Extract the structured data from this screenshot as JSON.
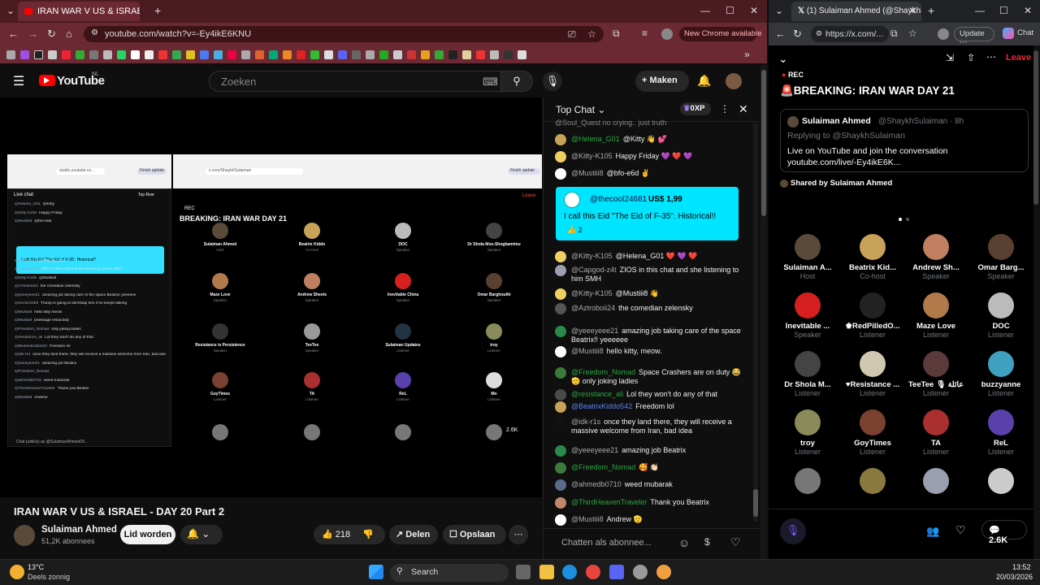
{
  "browser_left": {
    "tab_title": "IRAN WAR V US & ISRAEL",
    "url": "youtube.com/watch?v=-Ey4ikE6KNU",
    "new_chrome": "New Chrome available"
  },
  "youtube": {
    "brand": "YouTube",
    "region": "NL",
    "search_placeholder": "Zoeken",
    "create_label": "Maken",
    "video_title": "IRAN WAR V US & ISRAEL - DAY 20 Part 2",
    "channel_name": "Sulaiman Ahmed",
    "subscribers": "51,2K abonnees",
    "subscribe_label": "Lid worden",
    "likes": "218",
    "share_label": "Delen",
    "save_label": "Opslaan"
  },
  "embedded_capture": {
    "space_title": "BREAKING: IRAN WAR DAY 21",
    "rec": "REC",
    "live_chat": "Live chat",
    "top_row": "Top Row",
    "superchat_text": "I call this Eid 'The Eid of F-35'. Historical?",
    "count": "2.6K",
    "chat_publicly": "Chat publicly as @SulaimanAhmedOf...",
    "leave": "Leave",
    "left_url": "studio.youtube.co...",
    "right_url": "x.com/ShaykhSulaiman",
    "left_btn": "Finish update",
    "right_btn": "Finish update",
    "names": [
      {
        "n": "Sulaiman Ahmed",
        "r": "Host",
        "c": "#5a4a3a"
      },
      {
        "n": "Beatrix Kiddo",
        "r": "Co-host",
        "c": "#c9a25a"
      },
      {
        "n": "DOC",
        "r": "Speaker",
        "c": "#bbbbbb"
      },
      {
        "n": "Dr Shola Mos-Shogbamimu",
        "r": "Speaker",
        "c": "#444444"
      },
      {
        "n": "Maze Love",
        "r": "Speaker",
        "c": "#b07a4a"
      },
      {
        "n": "Andrew Sheets",
        "r": "Speaker",
        "c": "#c08060"
      },
      {
        "n": "Inevitable China",
        "r": "Speaker",
        "c": "#d62020"
      },
      {
        "n": "Omar Barghouthi",
        "r": "Speaker",
        "c": "#5a4030"
      },
      {
        "n": "Resistance is Persistence",
        "r": "Speaker",
        "c": "#333333"
      },
      {
        "n": "TeeTee",
        "r": "Speaker",
        "c": "#999999"
      },
      {
        "n": "Sulaiman Updates",
        "r": "Listener",
        "c": "#223344"
      },
      {
        "n": "troy",
        "r": "Listener",
        "c": "#8a8a5a"
      },
      {
        "n": "GoyTimes",
        "r": "Listener",
        "c": "#7a4030"
      },
      {
        "n": "TA",
        "r": "Listener",
        "c": "#aa3030"
      },
      {
        "n": "ReL",
        "r": "Listener",
        "c": "#5a40aa"
      },
      {
        "n": "Mo",
        "r": "Listener",
        "c": "#dddddd"
      }
    ],
    "chat_lines": [
      {
        "u": "@Helena_G01",
        "t": "@Kitty"
      },
      {
        "u": "@Kitty-K105",
        "t": "Happy Friday"
      },
      {
        "u": "@Mustiii8",
        "t": "@bfo-e6d"
      },
      {
        "u": "@Kitty-K105",
        "t": "@Helena_G01"
      },
      {
        "u": "@Capgod-z4t",
        "t": "ZIOS in this chat and she listening to him SMH"
      },
      {
        "u": "@Kitty-K105",
        "t": "@Mustiii8"
      },
      {
        "u": "@Aztroboii24",
        "t": "the comedian zelensky"
      },
      {
        "u": "@yeeeyeee21",
        "t": "amazing job taking care of the space Beatrix! yeeeeee"
      },
      {
        "u": "@vectorS255",
        "t": "Trump is going to bitchslap him if he keeps talking"
      },
      {
        "u": "@Mustiii8",
        "t": "hello kitty meow"
      },
      {
        "u": "@Mustiii8",
        "t": "[message retracted]"
      },
      {
        "u": "@Freedom_Nomad",
        "t": "only joking ladies"
      },
      {
        "u": "@resistance_ali",
        "t": "Lol they won't do any of that"
      },
      {
        "u": "@BeatrixKiddo542",
        "t": "Freedom lol"
      },
      {
        "u": "@idk-r1s",
        "t": "once they land there, they will receive a massive welcome from Iran, bad idea"
      },
      {
        "u": "@yeeeyeee21",
        "t": "amazing job Beatrix"
      },
      {
        "u": "@Freedom_Nomad",
        "t": ""
      },
      {
        "u": "@ahmedb0710",
        "t": "weed mubarak"
      },
      {
        "u": "@ThirdHeavenTraveler",
        "t": "Thank you Beatrix"
      },
      {
        "u": "@Mustiii8",
        "t": "Andrew"
      }
    ]
  },
  "chat": {
    "header": "Top Chat",
    "points": "0XP",
    "input_placeholder": "Chatten als abonnee...",
    "top_cut": "@Soul_Quest no crying.. just truth",
    "superchat": {
      "user": "@thecool24681",
      "amount": "US$ 1,99",
      "text": "I call this Eid \"The Eid of F-35\". Historical!!",
      "likes": "2"
    },
    "messages": [
      {
        "u": "@Helena_G01",
        "t": "@Kitty 👋 💕",
        "c": "g",
        "av": "#c9a25a"
      },
      {
        "u": "@Kitty-K105",
        "t": "Happy Friday 💜 ❤️ 💜",
        "c": "",
        "av": "#f0d060"
      },
      {
        "u": "@Mustiii8",
        "t": "@bfo-e6d ✌️",
        "c": "",
        "av": "#ffffff"
      },
      {
        "u": "@Kitty-K105",
        "t": "@Helena_G01 ❤️ 💜 ❤️",
        "c": "",
        "av": "#f0d060"
      },
      {
        "u": "@Capgod-z4t",
        "t": "ZIOS in this chat and she listening to him SMH",
        "c": "",
        "av": "#9aa0b0"
      },
      {
        "u": "@Kitty-K105",
        "t": "@Mustiii8 👋",
        "c": "",
        "av": "#f0d060"
      },
      {
        "u": "@Aztroboii24",
        "t": "the comedian zelensky",
        "c": "",
        "av": "#555555"
      },
      {
        "u": "@yeeeyeee21",
        "t": "amazing job taking care of the space Beatrix!! yeeeeee",
        "c": "",
        "av": "#2a8a4a"
      },
      {
        "u": "@Mustiii8",
        "t": "hello kitty, meow.",
        "c": "",
        "av": "#ffffff"
      },
      {
        "u": "@Freedom_Nomad",
        "t": "Space Crashers are on duty 😂 🫡 only joking ladies",
        "c": "g",
        "av": "#3a7a3a"
      },
      {
        "u": "@resistance_ali",
        "t": "Lol they won't do any of that",
        "c": "g",
        "av": "#4a4a4a"
      },
      {
        "u": "@BeatrixKiddo542",
        "t": "Freedom lol",
        "c": "b",
        "av": "#c9a25a"
      },
      {
        "u": "@idk-r1s",
        "t": "once they land there, they will receive a massive welcome from Iran, bad idea",
        "c": "",
        "av": "#111111"
      },
      {
        "u": "@yeeeyeee21",
        "t": "amazing job Beatrix",
        "c": "",
        "av": "#2a8a4a"
      },
      {
        "u": "@Freedom_Nomad",
        "t": "🥰 👏🏻",
        "c": "g",
        "av": "#3a7a3a"
      },
      {
        "u": "@ahmedb0710",
        "t": "weed mubarak",
        "c": "",
        "av": "#5a6a8a"
      },
      {
        "u": "@ThirdHeavenTraveler",
        "t": "Thank you Beatrix",
        "c": "g",
        "av": "#c08a6a"
      },
      {
        "u": "@Mustiii8",
        "t": "Andrew 🫡",
        "c": "",
        "av": "#ffffff"
      }
    ]
  },
  "browser_right": {
    "tab_title": "(1) Sulaiman Ahmed (@ShaykhSula...",
    "url": "https://x.com/...",
    "update_label": "Update",
    "chat_label": "Chat"
  },
  "xspace": {
    "rec": "REC",
    "title": "🚨BREAKING: IRAN WAR DAY 21",
    "leave": "Leave",
    "tweet_name": "Sulaiman Ahmed",
    "tweet_handle": "@ShaykhSulaiman · 8h",
    "replying": "Replying to @ShaykhSulaiman",
    "tweet_text": "Live on YouTube and join the conversation",
    "tweet_link": "youtube.com/live/-Ey4ikE6K...",
    "shared_by": "Shared by Sulaiman Ahmed",
    "count": "2.6K",
    "speakers": [
      {
        "n": "Sulaiman A...",
        "r": "Host",
        "c": "#5a4a3a"
      },
      {
        "n": "Beatrix Kid...",
        "r": "Co-host",
        "c": "#c9a25a"
      },
      {
        "n": "Andrew Sh...",
        "r": "Speaker",
        "c": "#c08060"
      },
      {
        "n": "Omar Barg...",
        "r": "Speaker",
        "c": "#5a4030"
      },
      {
        "n": "Inevitable ...",
        "r": "Speaker",
        "c": "#d62020"
      },
      {
        "n": "♚RedPilledO...",
        "r": "Listener",
        "c": "#222222"
      },
      {
        "n": "Maze Love",
        "r": "Listener",
        "c": "#b07a4a"
      },
      {
        "n": "DOC",
        "r": "Listener",
        "c": "#bbbbbb"
      },
      {
        "n": "Dr Shola M...",
        "r": "Listener",
        "c": "#444444"
      },
      {
        "n": "♥Resistance ...",
        "r": "Listener",
        "c": "#d0c8b0"
      },
      {
        "n": "TeeTee 🎙 عائلة",
        "r": "Listener",
        "c": "#5a3a3a"
      },
      {
        "n": "buzzyanne",
        "r": "Listener",
        "c": "#40a0c0"
      },
      {
        "n": "troy",
        "r": "Listener",
        "c": "#8a8a5a"
      },
      {
        "n": "GoyTimes",
        "r": "Listener",
        "c": "#7a4030"
      },
      {
        "n": "TA",
        "r": "Listener",
        "c": "#aa3030"
      },
      {
        "n": "ReL",
        "r": "Listener",
        "c": "#5a40aa"
      },
      {
        "n": "",
        "r": "",
        "c": "#777777"
      },
      {
        "n": "",
        "r": "",
        "c": "#8a7a40"
      },
      {
        "n": "",
        "r": "",
        "c": "#9aa0b0"
      },
      {
        "n": "",
        "r": "",
        "c": "#cccccc"
      }
    ]
  },
  "taskbar": {
    "temp": "13°C",
    "weather": "Deels zonnig",
    "search": "Search",
    "time": "13:52",
    "date": "20/03/2026"
  }
}
